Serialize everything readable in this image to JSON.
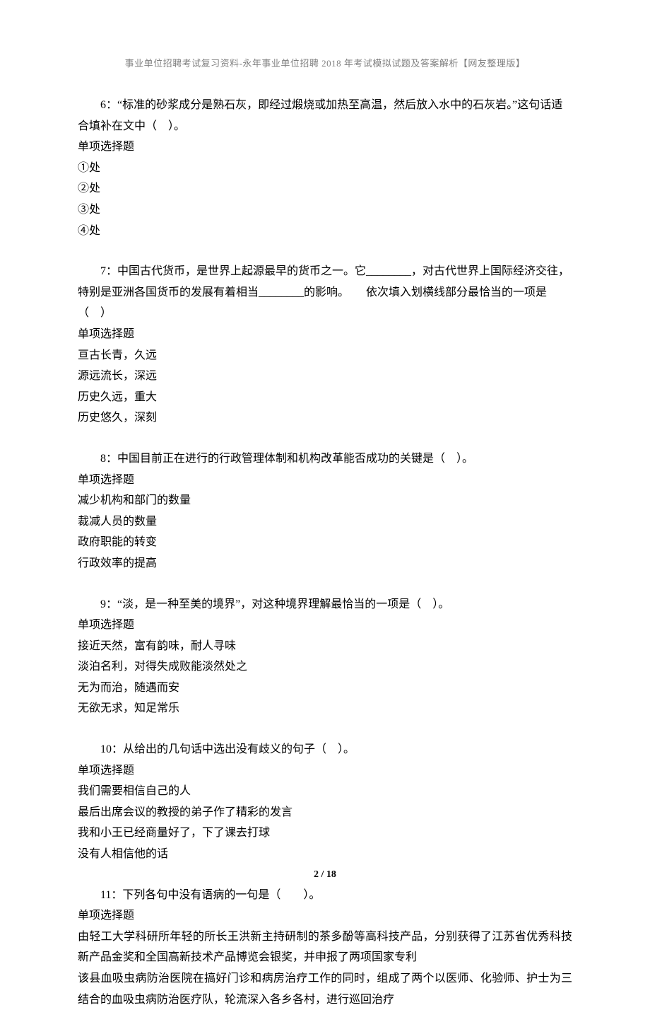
{
  "header": "事业单位招聘考试复习资料-永年事业单位招聘 2018 年考试模拟试题及答案解析【网友整理版】",
  "page_num": "2 / 18",
  "q6": {
    "text": "6：“标准的砂浆成分是熟石灰，即经过煅烧或加热至高温，然后放入水中的石灰岩。”这句话适合填补在文中（　）。",
    "type": "单项选择题",
    "opts": [
      "①处",
      "②处",
      "③处",
      "④处"
    ]
  },
  "q7": {
    "text": "7：中国古代货币，是世界上起源最早的货币之一。它________，对古代世界上国际经济交往，特别是亚洲各国货币的发展有着相当________的影响。　　依次填入划横线部分最恰当的一项是（　）",
    "type": "单项选择题",
    "opts": [
      "亘古长青，久远",
      "源远流长，深远",
      "历史久远，重大",
      "历史悠久，深刻"
    ]
  },
  "q8": {
    "text": "8：中国目前正在进行的行政管理体制和机构改革能否成功的关键是（　）。",
    "type": "单项选择题",
    "opts": [
      "减少机构和部门的数量",
      "裁减人员的数量",
      "政府职能的转变",
      "行政效率的提高"
    ]
  },
  "q9": {
    "text": "9：“淡，是一种至美的境界”，对这种境界理解最恰当的一项是（　）。",
    "type": "单项选择题",
    "opts": [
      "接近天然，富有韵味，耐人寻味",
      "淡泊名利，对得失成败能淡然处之",
      "无为而治，随遇而安",
      "无欲无求，知足常乐"
    ]
  },
  "q10": {
    "text": "10：从给出的几句话中选出没有歧义的句子（　）。",
    "type": "单项选择题",
    "opts": [
      "我们需要相信自己的人",
      "最后出席会议的教授的弟子作了精彩的发言",
      "我和小王已经商量好了，下了课去打球",
      "没有人相信他的话"
    ]
  },
  "q11": {
    "text": "11：下列各句中没有语病的一句是（　　）。",
    "type": "单项选择题",
    "opts": [
      "由轻工大学科研所年轻的所长王洪新主持研制的茶多酚等高科技产品，分别获得了江苏省优秀科技新产品金奖和全国高新技术产品博览会银奖，并申报了两项国家专利",
      "该县血吸虫病防治医院在搞好门诊和病房治疗工作的同时，组成了两个以医师、化验师、护士为三结合的血吸虫病防治医疗队，轮流深入各乡各村，进行巡回治疗"
    ]
  }
}
